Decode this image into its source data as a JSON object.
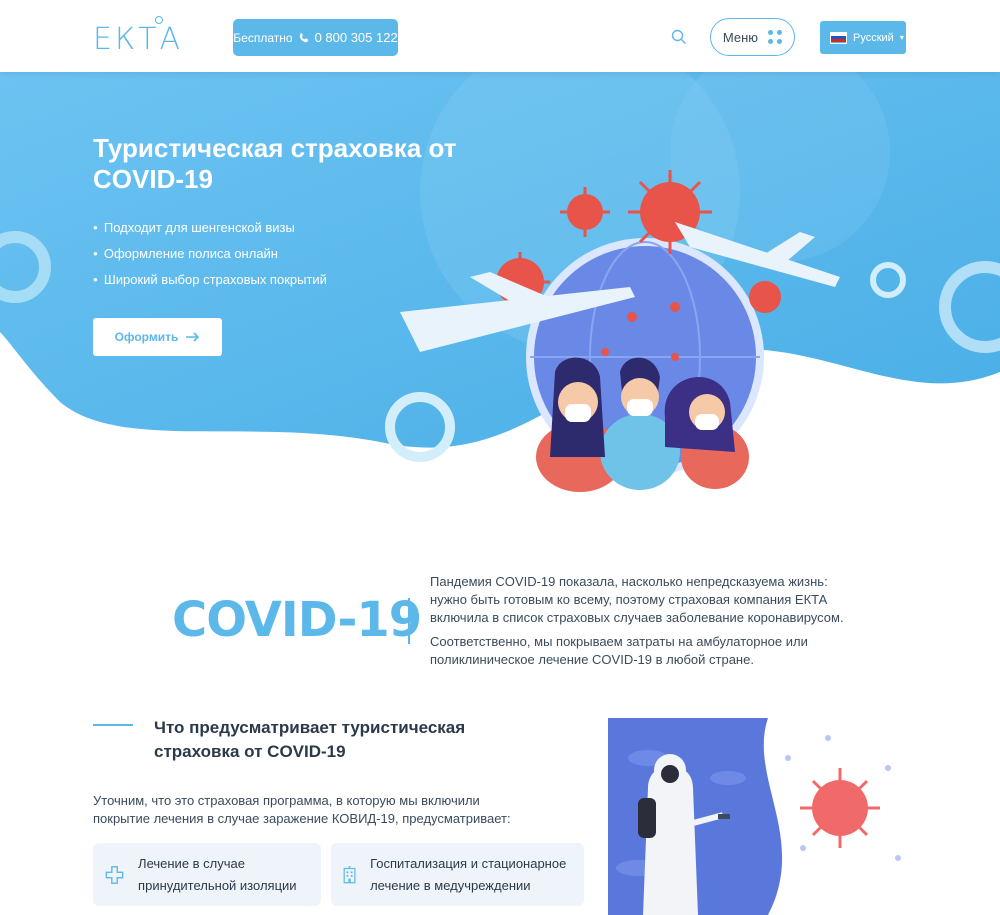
{
  "header": {
    "logo": "ЕКТА",
    "phone_prefix": "Бесплатно",
    "phone_number": "0 800 305 122",
    "menu_label": "Меню",
    "language": "Русский"
  },
  "hero": {
    "title": "Туристическая страховка от COVID-19",
    "bullets": [
      "Подходит для шенгенской визы",
      "Оформление полиса онлайн",
      "Широкий выбор страховых покрытий"
    ],
    "cta_label": "Оформить",
    "colors": {
      "primary": "#5bb8e8",
      "virus": "#e8534a"
    }
  },
  "covid_section": {
    "heading": "COVID-19",
    "paragraph1": "Пандемия COVID-19 показала, насколько непредсказуема жизнь: нужно быть готовым ко всему, поэтому страховая компания ЕКТА включила в список страховых случаев заболевание коронавирусом.",
    "paragraph2": "Соответственно, мы покрываем затраты на амбулаторное или поликлиническое лечение COVID-19  в любой стране."
  },
  "coverage_section": {
    "title": "Что предусматривает туристическая страховка от COVID-19",
    "intro": "Уточним, что это страховая программа, в которую мы включили покрытие лечения в случае заражение КОВИД-19, предусматривает:",
    "cards": [
      {
        "icon": "medical-cross-icon",
        "label": "Лечение в случае принудительной изоляции"
      },
      {
        "icon": "hospital-building-icon",
        "label": "Госпитализация и стационарное лечение в медучреждении"
      }
    ]
  }
}
